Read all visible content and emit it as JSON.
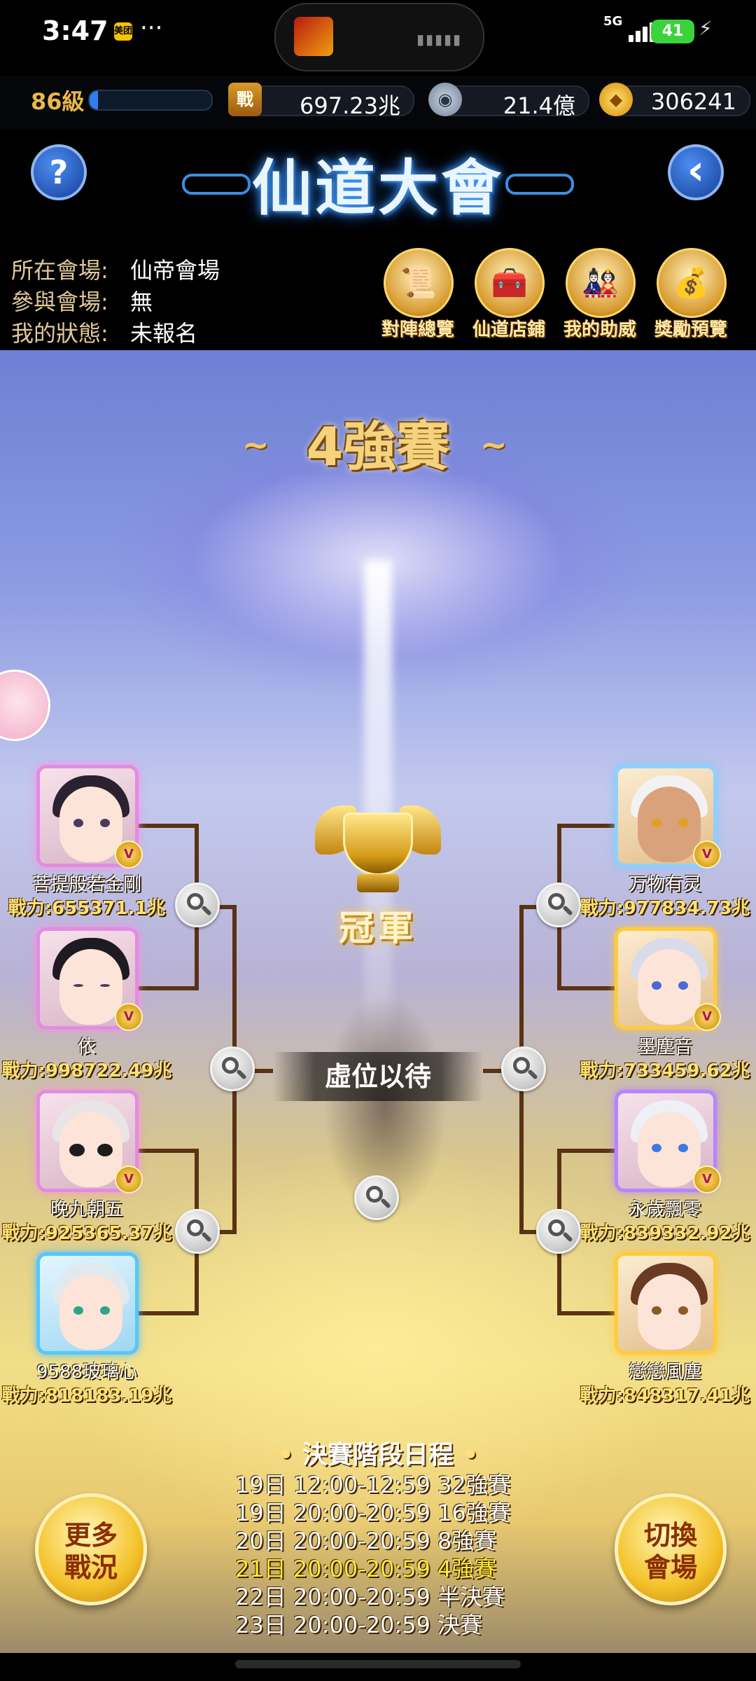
{
  "status_bar": {
    "time": "3:47",
    "app_badge": "美团",
    "dots": "···",
    "network": "5G",
    "battery": "41"
  },
  "resources": {
    "level": "86級",
    "xp_progress_percent": 7,
    "power_icon_text": "戰",
    "power": "697.23兆",
    "silver": "21.4億",
    "gold": "306241"
  },
  "header": {
    "title": "仙道大會",
    "help_glyph": "?",
    "back_glyph": "‹"
  },
  "info": [
    {
      "label": "所在會場:",
      "value": "仙帝會場"
    },
    {
      "label": "參與會場:",
      "value": "無"
    },
    {
      "label": "我的狀態:",
      "value": "未報名"
    }
  ],
  "menu": [
    {
      "label": "對陣總覽",
      "icon": "scroll-icon"
    },
    {
      "label": "仙道店鋪",
      "icon": "treasure-chest-icon"
    },
    {
      "label": "我的助威",
      "icon": "cheer-icon"
    },
    {
      "label": "獎勵預覽",
      "icon": "reward-chest-icon"
    }
  ],
  "stage_title": "4強賽",
  "champion_label": "冠軍",
  "pending_text": "虛位以待",
  "power_prefix": "戰力:",
  "players_left": [
    {
      "name": "菩提般若金剛",
      "power": "655371.1兆"
    },
    {
      "name": "依",
      "power": "998722.49兆"
    },
    {
      "name": "晚九朝五",
      "power": "925365.37兆"
    },
    {
      "name": "9588玻璃心",
      "power": "818183.19兆"
    }
  ],
  "players_right": [
    {
      "name": "万物有灵",
      "power": "977834.73兆"
    },
    {
      "name": "墨塵音",
      "power": "733459.62兆"
    },
    {
      "name": "永歲飄零",
      "power": "839332.92兆"
    },
    {
      "name": "戀戀風塵",
      "power": "848317.41兆"
    }
  ],
  "schedule": {
    "title": "決賽階段日程",
    "items": [
      "19日 12:00-12:59 32強賽",
      "19日 20:00-20:59 16強賽",
      "20日 20:00-20:59 8強賽",
      "21日 20:00-20:59 4強賽",
      "22日 20:00-20:59 半決賽",
      "23日 20:00-20:59 決賽"
    ],
    "current_index": 3
  },
  "buttons": {
    "more_battle_1": "更多",
    "more_battle_2": "戰況",
    "switch_venue_1": "切換",
    "switch_venue_2": "會場"
  }
}
